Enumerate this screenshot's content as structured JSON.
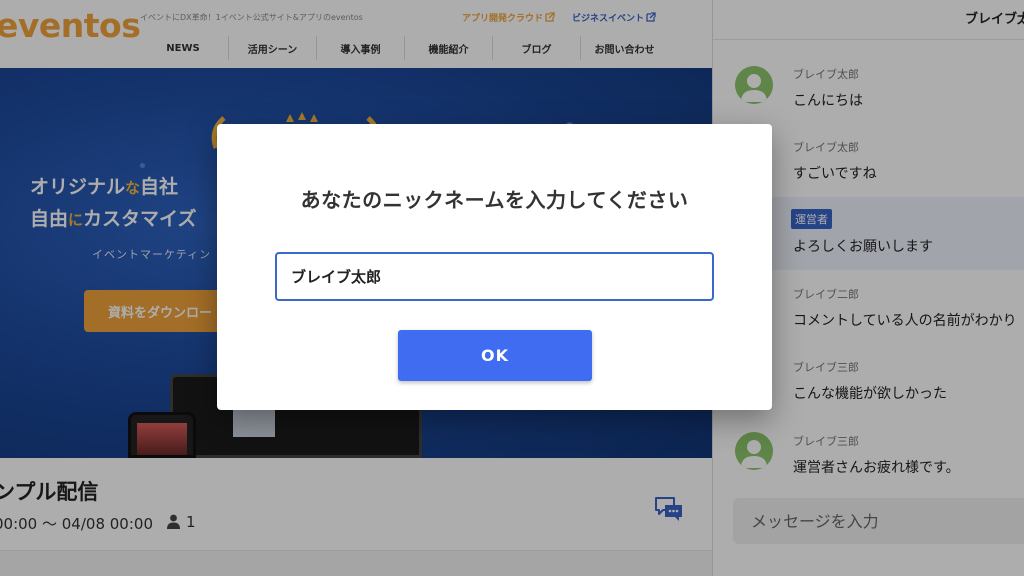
{
  "site": {
    "logo": "eventos",
    "tagline": "イベントにDX革命！1イベント公式サイト&アプリのeventos",
    "links": {
      "app_cloud": "アプリ開発クラウド",
      "business_event": "ビジネスイベント"
    },
    "nav": [
      "NEWS",
      "活用シーン",
      "導入事例",
      "機能紹介",
      "ブログ",
      "お問い合わせ"
    ]
  },
  "hero": {
    "title_line1_a": "オリジナル",
    "title_line1_b": "な",
    "title_line1_c": "自社",
    "title_line2_a": "自由",
    "title_line2_b": "に",
    "title_line2_c": "カスタマイズ",
    "subtitle": "イベントマーケティン",
    "cta_label": "資料をダウンロー"
  },
  "video": {
    "title": "ンプル配信",
    "time_range": "00:00 ～ 04/08 00:00",
    "viewer_count": "1"
  },
  "chat": {
    "header_name": "ブレイブ太郎",
    "messages": [
      {
        "name": "ブレイブ太郎",
        "text": "こんにちは",
        "avatar": true,
        "staff": false
      },
      {
        "name": "ブレイブ太郎",
        "text": "すごいですね",
        "avatar": false,
        "staff": false
      },
      {
        "badge": "運営者",
        "text": "よろしくお願いします",
        "avatar": false,
        "staff": true
      },
      {
        "name": "ブレイブ二郎",
        "text": "コメントしている人の名前がわかり",
        "avatar": false,
        "staff": false
      },
      {
        "name": "ブレイブ三郎",
        "text": "こんな機能が欲しかった",
        "avatar": false,
        "staff": false
      },
      {
        "name": "ブレイブ三郎",
        "text": "運営者さんお疲れ様です。",
        "avatar": true,
        "staff": false
      }
    ],
    "input_placeholder": "メッセージを入力"
  },
  "dialog": {
    "title": "あなたのニックネームを入力してください",
    "input_value": "ブレイブ太郎",
    "ok_label": "OK"
  },
  "colors": {
    "brand_orange": "#f0a33a",
    "primary_blue": "#3f6cf0",
    "avatar_green": "#8cc46a"
  }
}
